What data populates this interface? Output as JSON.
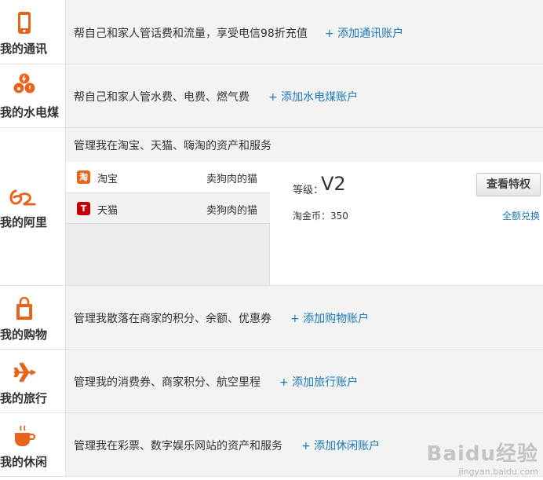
{
  "categories": [
    {
      "label": "我的通讯",
      "desc": "帮自己和家人管话费和流量，享受电信98折充值",
      "link": "+ 添加通讯账户",
      "icon": "phone-icon"
    },
    {
      "label": "我的水电煤",
      "desc": "帮自己和家人管水费、电费、燃气费",
      "link": "+ 添加水电煤账户",
      "icon": "utility-icon"
    },
    {
      "label": "我的阿里",
      "desc": "管理我在淘宝、天猫、嗨淘的资产和服务",
      "icon": "alibaba-icon"
    },
    {
      "label": "我的购物",
      "desc": "管理我散落在商家的积分、余额、优惠券",
      "link": "+ 添加购物账户",
      "icon": "shopping-bag-icon"
    },
    {
      "label": "我的旅行",
      "desc": "管理我的消费券、商家积分、航空里程",
      "link": "+ 添加旅行账户",
      "icon": "airplane-icon"
    },
    {
      "label": "我的休闲",
      "desc": "管理我在彩票、数字娱乐网站的资产和服务",
      "link": "+ 添加休闲账户",
      "icon": "coffee-cup-icon"
    }
  ],
  "ali": {
    "items": [
      {
        "icon_text": "淘",
        "name": "淘宝",
        "account": "卖狗肉的猫",
        "icon": "taobao-icon"
      },
      {
        "icon_text": "T",
        "name": "天猫",
        "account": "卖狗肉的猫",
        "icon": "tmall-icon"
      }
    ],
    "level_label": "等级：",
    "level_value": "V2",
    "coin": "淘金币：350",
    "exchange": "全额兑换",
    "privilege_button": "查看特权"
  },
  "watermark": {
    "brand": "Baidu经验",
    "url": "jingyan.baidu.com"
  },
  "colors": {
    "accent": "#e8641c",
    "link": "#1a7ab5",
    "tmall": "#c40000"
  }
}
